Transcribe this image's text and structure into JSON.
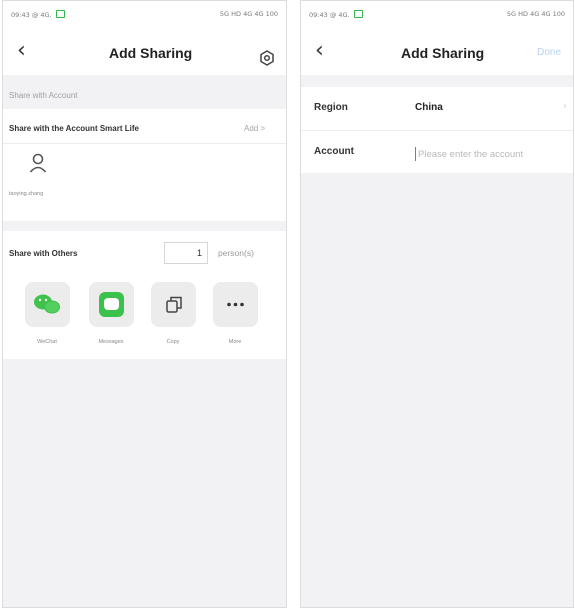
{
  "left_screen": {
    "status": {
      "time": "09:43",
      "indicators": "@ 4G.",
      "right": "5G HD 4G 4G 100"
    },
    "title": "Add Sharing",
    "section_label": "Share with Account",
    "account_row": {
      "title": "Share with the Account Smart Life",
      "add_label": "Add >"
    },
    "shared_user": {
      "name": "taoying.zhang"
    },
    "others_row": {
      "title": "Share with Others",
      "count": "1",
      "unit": "person(s)"
    },
    "share_apps": [
      {
        "label": "WeChat",
        "icon": "wechat-icon"
      },
      {
        "label": "Messages",
        "icon": "messages-icon"
      },
      {
        "label": "Copy",
        "icon": "copy-icon"
      },
      {
        "label": "More",
        "icon": "more-icon"
      }
    ]
  },
  "right_screen": {
    "status": {
      "time": "09:43",
      "indicators": "@ 4G.",
      "right": "5G HD 4G 4G 100"
    },
    "title": "Add Sharing",
    "done_label": "Done",
    "region": {
      "label": "Region",
      "value": "China"
    },
    "account": {
      "label": "Account",
      "placeholder": "Please enter the account",
      "value": ""
    }
  },
  "colors": {
    "wechat_green": "#3fc34c",
    "messages_green": "#3cc24c",
    "done_disabled": "#b8d3f2",
    "cursor_blue": "#3a8ee6"
  }
}
